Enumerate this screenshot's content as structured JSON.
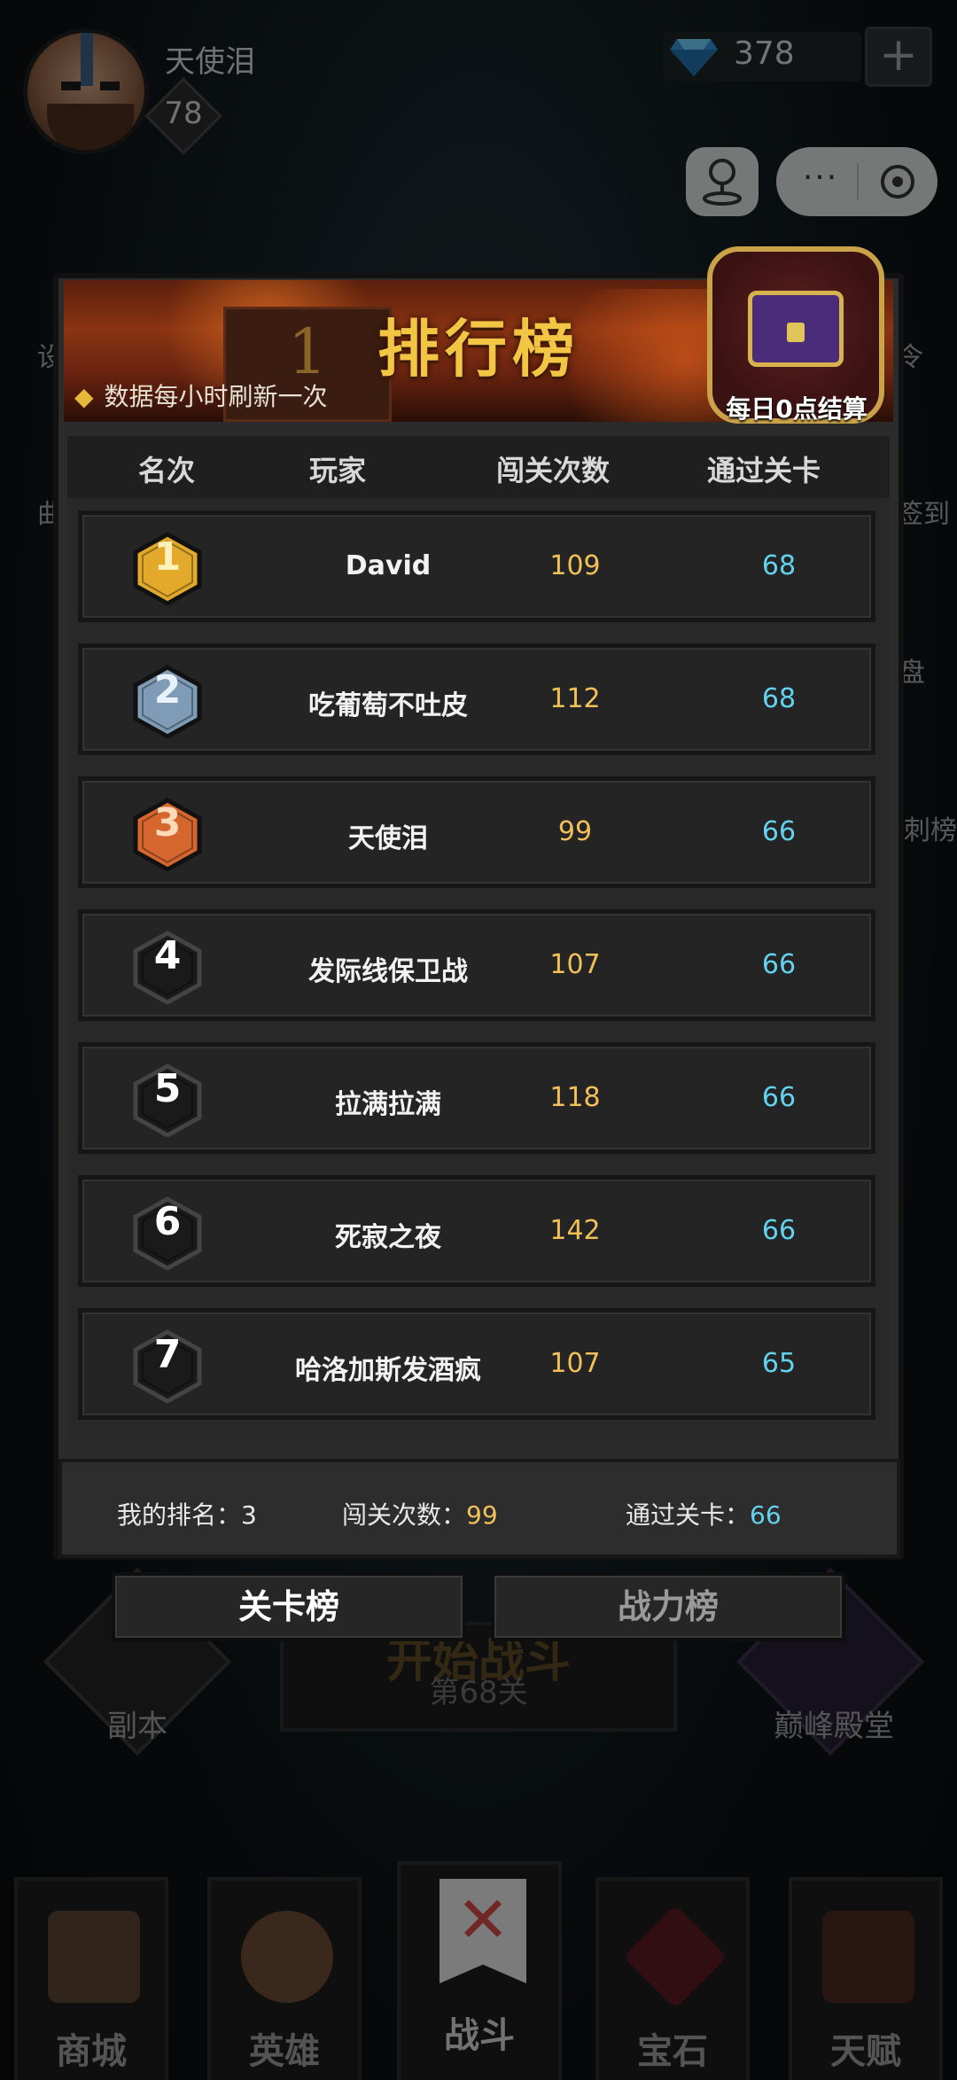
{
  "header": {
    "username": "天使泪",
    "level": "78",
    "gems": "378",
    "add_gems_label": "+",
    "more_label": "···"
  },
  "side_labels": {
    "left_top": "设",
    "left_mid": "曲",
    "right_top": "令",
    "right_signin": "签到",
    "right_pan": "盘",
    "right_list": "刺榜"
  },
  "background": {
    "start_title": "开始战斗",
    "start_stage": "第68关",
    "dungeon": "副本",
    "peak_hall": "巅峰殿堂"
  },
  "nav": {
    "items": [
      {
        "label": "商城"
      },
      {
        "label": "英雄"
      },
      {
        "label": "战斗"
      },
      {
        "label": "宝石"
      },
      {
        "label": "天赋"
      }
    ]
  },
  "modal": {
    "title": "排行榜",
    "subtitle": "数据每小时刷新一次",
    "banner_rank": "1",
    "chest_label": "每日0点结算",
    "columns": [
      "名次",
      "玩家",
      "闯关次数",
      "通过关卡"
    ],
    "rows": [
      {
        "rank": "1",
        "player": "David",
        "tries": "109",
        "stage": "68"
      },
      {
        "rank": "2",
        "player": "吃葡萄不吐皮",
        "tries": "112",
        "stage": "68"
      },
      {
        "rank": "3",
        "player": "天使泪",
        "tries": "99",
        "stage": "66"
      },
      {
        "rank": "4",
        "player": "发际线保卫战",
        "tries": "107",
        "stage": "66"
      },
      {
        "rank": "5",
        "player": "拉满拉满",
        "tries": "118",
        "stage": "66"
      },
      {
        "rank": "6",
        "player": "死寂之夜",
        "tries": "142",
        "stage": "66"
      },
      {
        "rank": "7",
        "player": "哈洛加斯发酒疯",
        "tries": "107",
        "stage": "65"
      }
    ],
    "my_rank_label": "我的排名：",
    "my_rank_value": "3",
    "my_tries_label": "闯关次数：",
    "my_tries_value": "99",
    "my_stage_label": "通过关卡：",
    "my_stage_value": "66",
    "tab_stage": "关卡榜",
    "tab_power": "战力榜"
  },
  "colors": {
    "gold": "#f1c058",
    "cyan": "#62d2ee",
    "rank1": "#e2a92a",
    "rank2": "#7f9bb5",
    "rank3": "#d4662e",
    "rank_default": "#1a1a1a"
  }
}
